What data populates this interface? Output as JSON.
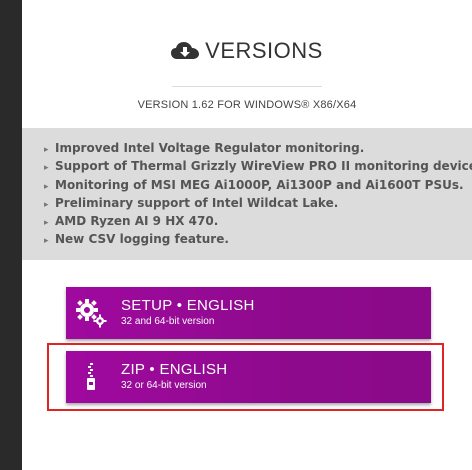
{
  "header": {
    "title": "VERSIONS",
    "version_line": "VERSION 1.62 FOR WINDOWS® X86/X64"
  },
  "features": {
    "items": [
      "Improved Intel Voltage Regulator monitoring.",
      "Support of Thermal Grizzly WireView PRO II monitoring device.",
      "Monitoring of MSI MEG Ai1000P, Ai1300P and Ai1600T PSUs.",
      "Preliminary support of Intel Wildcat Lake.",
      "AMD Ryzen AI 9 HX 470.",
      "New CSV logging feature."
    ],
    "bullet_glyph": "▸"
  },
  "downloads": {
    "setup": {
      "label": "SETUP • ENGLISH",
      "sublabel": "32 and 64-bit version",
      "icon": "gears-icon"
    },
    "zip": {
      "label": "ZIP • ENGLISH",
      "sublabel": "32 or 64-bit version",
      "icon": "zip-file-icon"
    }
  },
  "colors": {
    "accent": "#9a099a",
    "highlight": "#e02424",
    "feature_bg": "#dcdcdc",
    "text": "#333333"
  }
}
